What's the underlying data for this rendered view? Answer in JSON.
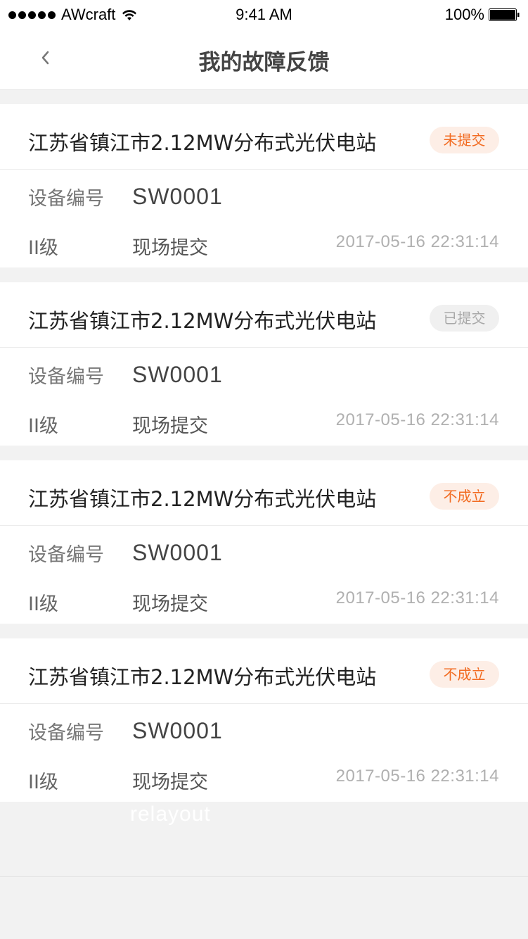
{
  "status_bar": {
    "carrier": "AWcraft",
    "time": "9:41 AM",
    "battery": "100%"
  },
  "nav": {
    "title": "我的故障反馈"
  },
  "labels": {
    "device_number": "设备编号"
  },
  "items": [
    {
      "title": "江苏省镇江市2.12MW分布式光伏电站",
      "status": "未提交",
      "device_code": "SW0001",
      "level": "II级",
      "source": "现场提交",
      "timestamp": "2017-05-16  22:31:14"
    },
    {
      "title": "江苏省镇江市2.12MW分布式光伏电站",
      "status": "已提交",
      "device_code": "SW0001",
      "level": "II级",
      "source": "现场提交",
      "timestamp": "2017-05-16  22:31:14"
    },
    {
      "title": "江苏省镇江市2.12MW分布式光伏电站",
      "status": "不成立",
      "device_code": "SW0001",
      "level": "II级",
      "source": "现场提交",
      "timestamp": "2017-05-16  22:31:14"
    },
    {
      "title": "江苏省镇江市2.12MW分布式光伏电站",
      "status": "不成立",
      "device_code": "SW0001",
      "level": "II级",
      "source": "现场提交",
      "timestamp": "2017-05-16  22:31:14"
    }
  ],
  "watermark": "relayout",
  "colors": {
    "accent_orange": "#f26b21",
    "accent_orange_bg": "#fdeee6",
    "muted_badge_bg": "#f0f0f0",
    "page_bg": "#f2f2f2"
  },
  "icons": {
    "back": "chevron-left-icon",
    "wifi": "wifi-icon",
    "battery": "battery-icon",
    "signal": "signal-dots-icon"
  }
}
